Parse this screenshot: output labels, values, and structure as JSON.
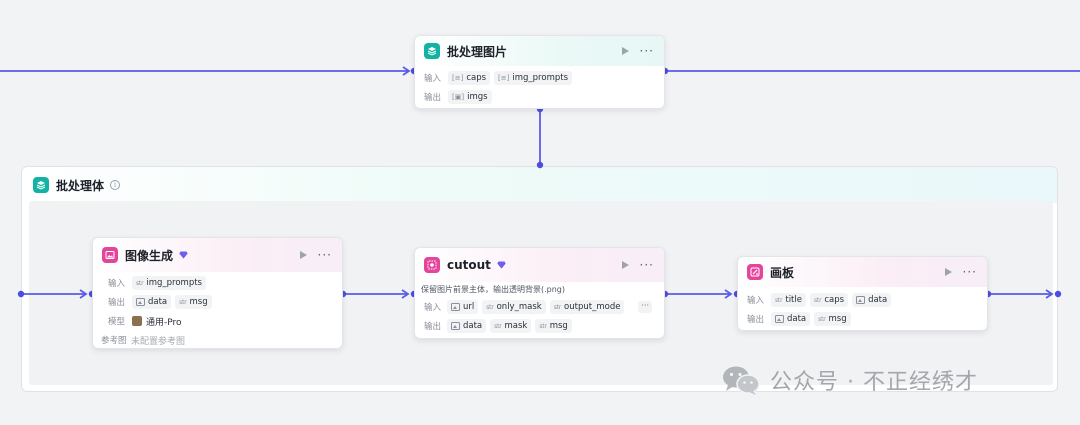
{
  "colors": {
    "accent": "#5b5ce6",
    "teal": "#12b3a4",
    "pink": "#e4459b"
  },
  "group": {
    "title": "批处理体",
    "icon": "layers-icon",
    "info_icon": "ⓘ"
  },
  "batch_node": {
    "title": "批处理图片",
    "icon": "layers-icon",
    "input_label": "输入",
    "output_label": "输出",
    "inputs": [
      {
        "type": "list",
        "name": "caps"
      },
      {
        "type": "list",
        "name": "img_prompts"
      }
    ],
    "outputs": [
      {
        "type": "image-list",
        "name": "imgs"
      }
    ]
  },
  "image_gen_node": {
    "title": "图像生成",
    "icon": "image-icon",
    "input_label": "输入",
    "output_label": "输出",
    "model_label": "模型",
    "reference_label": "参考图",
    "inputs": [
      {
        "type": "str",
        "name": "img_prompts"
      }
    ],
    "outputs": [
      {
        "type": "image",
        "name": "data"
      },
      {
        "type": "str",
        "name": "msg"
      }
    ],
    "model_value": "通用-Pro",
    "reference_value": "未配置参考图"
  },
  "cutout_node": {
    "title": "cutout",
    "icon": "cutout-icon",
    "description": "保留图片前景主体，输出透明背景(.png)",
    "input_label": "输入",
    "output_label": "输出",
    "inputs": [
      {
        "type": "image",
        "name": "url"
      },
      {
        "type": "str",
        "name": "only_mask"
      },
      {
        "type": "str",
        "name": "output_mode"
      }
    ],
    "outputs": [
      {
        "type": "image",
        "name": "data"
      },
      {
        "type": "str",
        "name": "mask"
      },
      {
        "type": "str",
        "name": "msg"
      }
    ],
    "more": "···"
  },
  "canvas_node": {
    "title": "画板",
    "icon": "canvas-icon",
    "input_label": "输入",
    "output_label": "输出",
    "inputs": [
      {
        "type": "str",
        "name": "title"
      },
      {
        "type": "str",
        "name": "caps"
      },
      {
        "type": "image",
        "name": "data"
      }
    ],
    "outputs": [
      {
        "type": "image",
        "name": "data"
      },
      {
        "type": "str",
        "name": "msg"
      }
    ]
  },
  "type_labels": {
    "str": "str",
    "list": "[str]"
  },
  "controls": {
    "run": "▶",
    "more": "···"
  },
  "watermark": {
    "text": "公众号 · 不正经绣才",
    "icon": "wechat-icon"
  }
}
